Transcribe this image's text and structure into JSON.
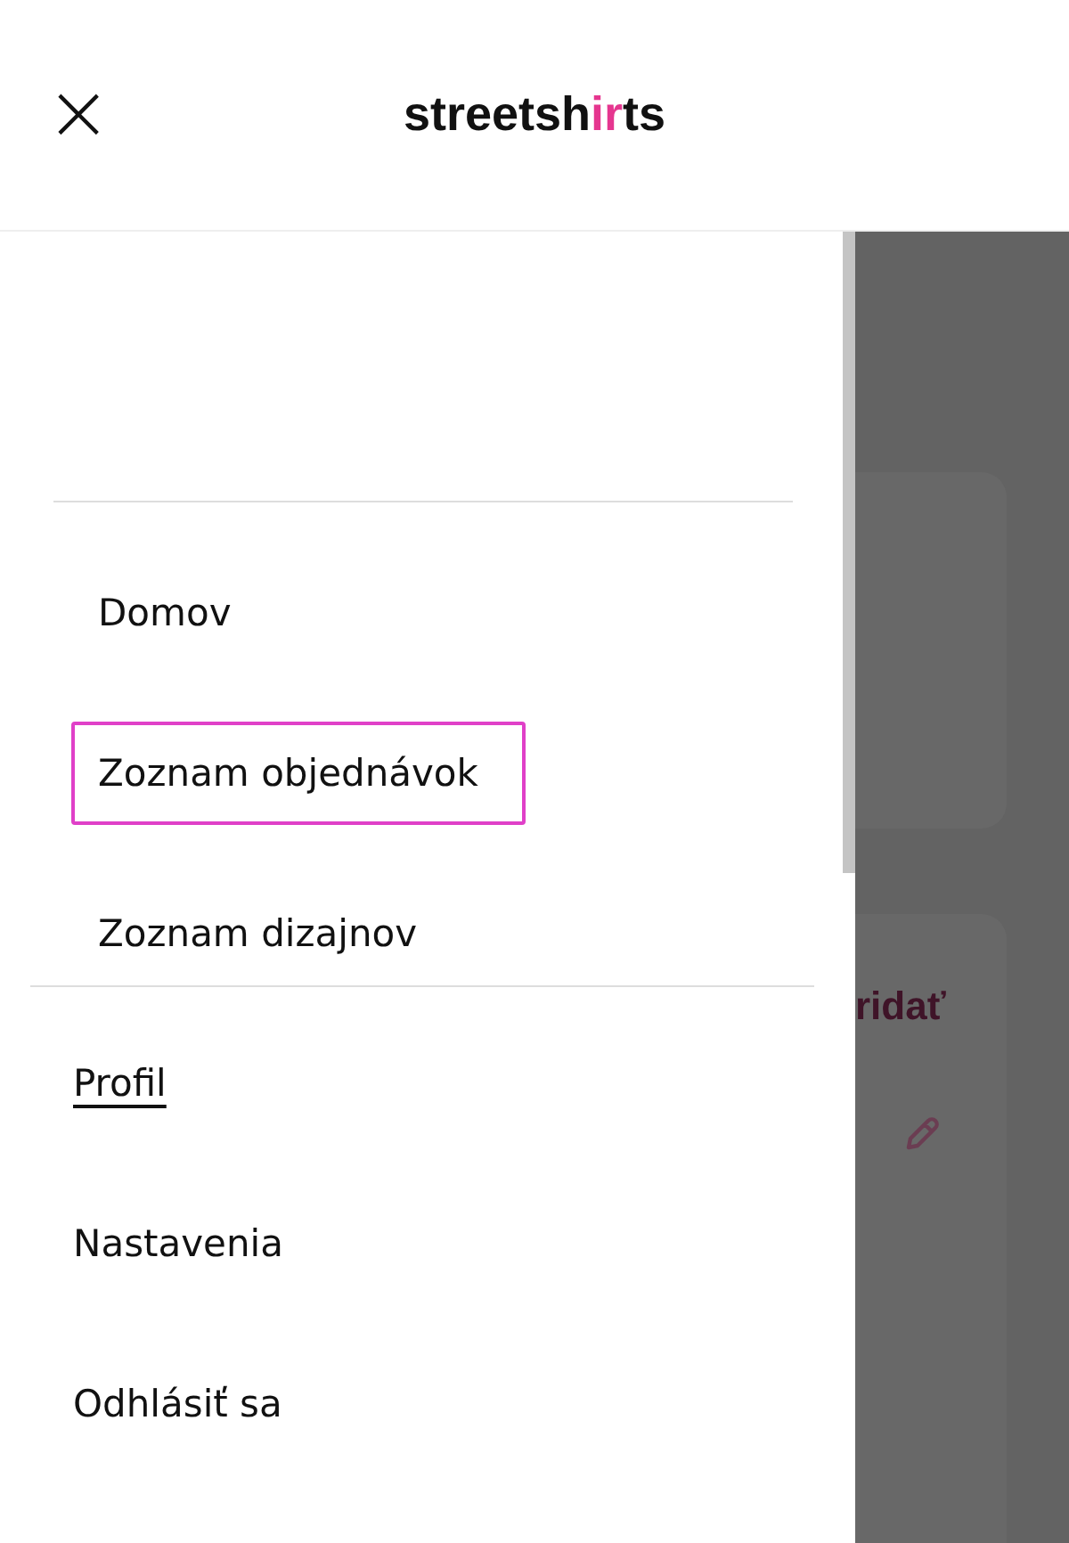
{
  "header": {
    "close_icon": "×",
    "logo": [
      {
        "text": "streetsh",
        "accent": false
      },
      {
        "text": "ir",
        "accent": true
      },
      {
        "text": "ts",
        "accent": false
      }
    ]
  },
  "menu": [
    {
      "label": "Domov",
      "focused": false
    },
    {
      "label": "Zoznam objednávok",
      "focused": true
    },
    {
      "label": "Zoznam dizajnov",
      "focused": false
    }
  ],
  "account_menu": [
    {
      "label": "Profil",
      "selected": true
    },
    {
      "label": "Nastavenia",
      "selected": false
    },
    {
      "label": "Odhlásiť sa",
      "selected": false
    }
  ],
  "background": {
    "action_text": "ridať"
  }
}
